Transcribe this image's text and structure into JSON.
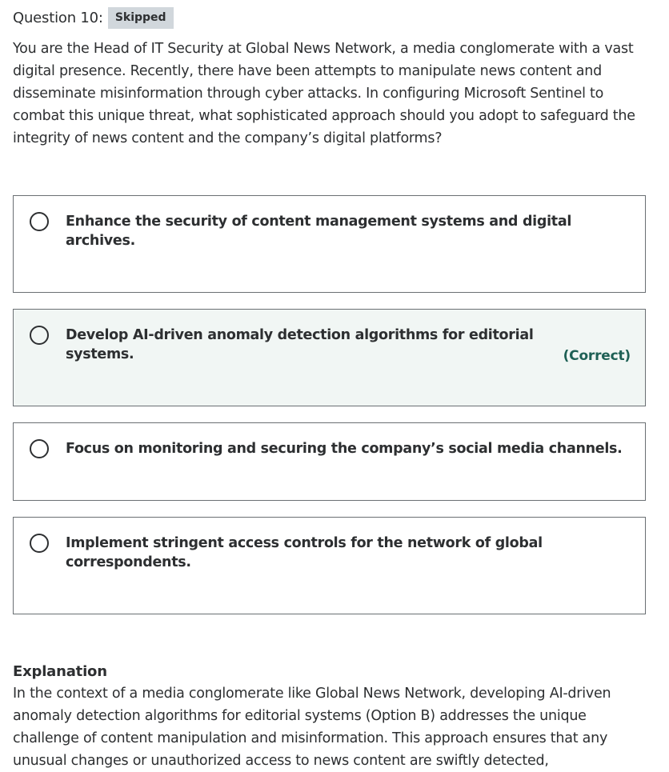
{
  "question": {
    "title": "Question 10:",
    "status_badge": "Skipped",
    "text": "You are the Head of IT Security at Global News Network, a media conglomerate with a vast digital presence. Recently, there have been attempts to manipulate news content and disseminate misinformation through cyber attacks. In configuring Microsoft Sentinel to combat this unique threat, what sophisticated approach should you adopt to safeguard the integrity of news content and the company’s digital platforms?"
  },
  "options": [
    {
      "label": "Enhance the security of content management systems and digital archives."
    },
    {
      "label": "Develop AI-driven anomaly detection algorithms for editorial systems.",
      "correct_tag": "(Correct)"
    },
    {
      "label": "Focus on monitoring and securing the company’s social media channels."
    },
    {
      "label": "Implement stringent access controls for the network of global correspondents."
    }
  ],
  "explanation": {
    "title": "Explanation",
    "text": "In the context of a media conglomerate like Global News Network, developing AI-driven anomaly detection algorithms for editorial systems (Option B) addresses the unique challenge of content manipulation and misinformation. This approach ensures that any unusual changes or unauthorized access to news content are swiftly detected,"
  },
  "colors": {
    "badge_bg": "#d1d7dc",
    "correct_bg": "#f1f6f4",
    "correct_text": "#1e6055",
    "border": "#6a6f73",
    "text": "#2d2f31"
  }
}
